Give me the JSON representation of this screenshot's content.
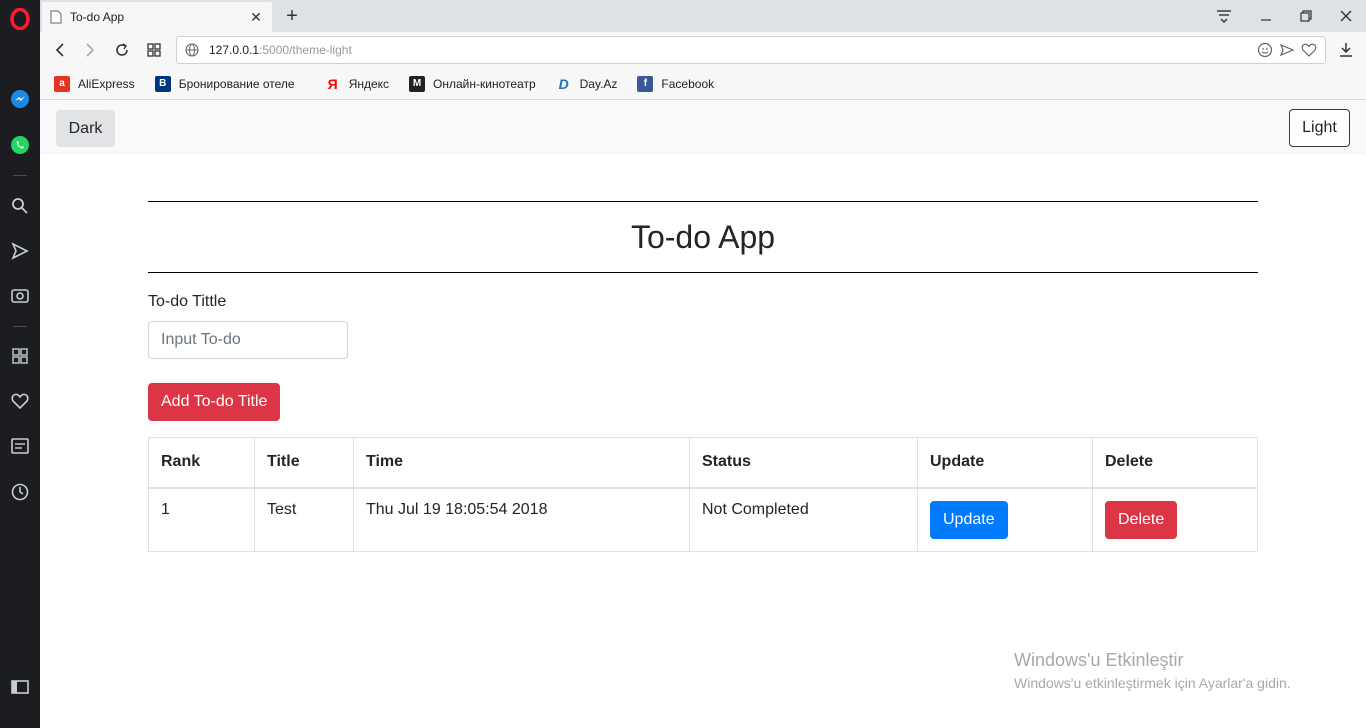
{
  "browser": {
    "tab_title": "To-do App",
    "url_host": "127.0.0.1",
    "url_path": ":5000/theme-light",
    "bookmarks": [
      {
        "label": "AliExpress",
        "icon": "aliexpress-icon",
        "color": "#e43225"
      },
      {
        "label": "Бронирование отеле",
        "icon": "booking-icon",
        "color": "#003580"
      },
      {
        "label": "Яндекс",
        "icon": "yandex-icon",
        "color": "#ff0000"
      },
      {
        "label": "Онлайн-кинотеатр",
        "icon": "cinema-icon",
        "color": "#222222"
      },
      {
        "label": "Day.Az",
        "icon": "dayaz-icon",
        "color": "#1e73be"
      },
      {
        "label": "Facebook",
        "icon": "facebook-icon",
        "color": "#3b5998"
      }
    ]
  },
  "navbar": {
    "dark_label": "Dark",
    "light_label": "Light"
  },
  "app": {
    "title": "To-do App",
    "form_label": "To-do Tittle",
    "input_placeholder": "Input To-do",
    "add_button": "Add To-do Title"
  },
  "table": {
    "headers": [
      "Rank",
      "Title",
      "Time",
      "Status",
      "Update",
      "Delete"
    ],
    "rows": [
      {
        "rank": "1",
        "title": "Test",
        "time": "Thu Jul 19 18:05:54 2018",
        "status": "Not Completed",
        "update_label": "Update",
        "delete_label": "Delete"
      }
    ]
  },
  "watermark": {
    "line1": "Windows'u Etkinleştir",
    "line2": "Windows'u etkinleştirmek için Ayarlar'a gidin."
  },
  "colors": {
    "primary": "#007bff",
    "danger": "#dc3545",
    "navbar_bg": "#f8f9fa"
  }
}
